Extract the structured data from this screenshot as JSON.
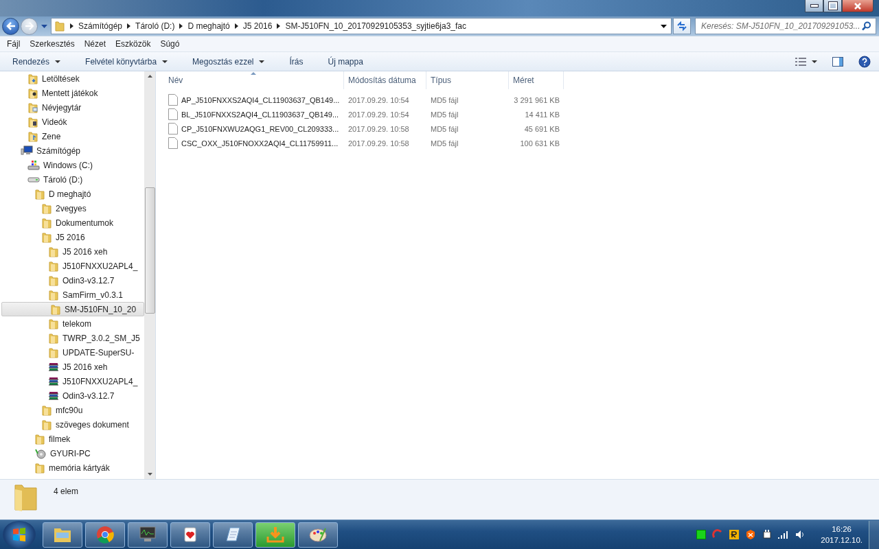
{
  "address_bar": {
    "path": [
      "Számítógép",
      "Tároló (D:)",
      "D meghajtó",
      "J5 2016",
      "SM-J510FN_10_20170929105353_syjtie6ja3_fac"
    ]
  },
  "search": {
    "placeholder": "Keresés: SM-J510FN_10_201709291053..."
  },
  "menu": [
    "Fájl",
    "Szerkesztés",
    "Nézet",
    "Eszközök",
    "Súgó"
  ],
  "toolbar": [
    {
      "label": "Rendezés",
      "dropdown": true
    },
    {
      "label": "Felvétel könyvtárba",
      "dropdown": true
    },
    {
      "label": "Megosztás ezzel",
      "dropdown": true
    },
    {
      "label": "Írás",
      "dropdown": false
    },
    {
      "label": "Új mappa",
      "dropdown": false
    }
  ],
  "sidebar": {
    "libraries": [
      {
        "label": "Letöltések",
        "kind": "downloads"
      },
      {
        "label": "Mentett játékok",
        "kind": "games"
      },
      {
        "label": "Névjegytár",
        "kind": "contacts"
      },
      {
        "label": "Videók",
        "kind": "videos"
      },
      {
        "label": "Zene",
        "kind": "music"
      }
    ],
    "tree": [
      {
        "label": "Számítógép",
        "kind": "computer",
        "selected": false,
        "children": [
          {
            "label": "Windows (C:)",
            "kind": "system-drive",
            "selected": false
          },
          {
            "label": "Tároló (D:)",
            "kind": "drive",
            "selected": false,
            "children": [
              {
                "label": "D meghajtó",
                "kind": "folder",
                "selected": false,
                "children": [
                  {
                    "label": "2vegyes",
                    "kind": "folder",
                    "selected": false
                  },
                  {
                    "label": "Dokumentumok",
                    "kind": "folder",
                    "selected": false
                  },
                  {
                    "label": "J5 2016",
                    "kind": "folder",
                    "selected": false,
                    "children": [
                      {
                        "label": "J5 2016 xeh",
                        "kind": "folder",
                        "selected": false
                      },
                      {
                        "label": "J510FNXXU2APL4_",
                        "kind": "folder",
                        "selected": false
                      },
                      {
                        "label": "Odin3-v3.12.7",
                        "kind": "folder",
                        "selected": false
                      },
                      {
                        "label": "SamFirm_v0.3.1",
                        "kind": "folder",
                        "selected": false
                      },
                      {
                        "label": "SM-J510FN_10_20",
                        "kind": "folder",
                        "selected": true
                      },
                      {
                        "label": "telekom",
                        "kind": "folder",
                        "selected": false
                      },
                      {
                        "label": "TWRP_3.0.2_SM_J5",
                        "kind": "folder",
                        "selected": false
                      },
                      {
                        "label": "UPDATE-SuperSU-",
                        "kind": "folder",
                        "selected": false
                      },
                      {
                        "label": "J5 2016 xeh",
                        "kind": "archive",
                        "selected": false
                      },
                      {
                        "label": "J510FNXXU2APL4_",
                        "kind": "archive",
                        "selected": false
                      },
                      {
                        "label": "Odin3-v3.12.7",
                        "kind": "archive",
                        "selected": false
                      }
                    ]
                  },
                  {
                    "label": "mfc90u",
                    "kind": "folder",
                    "selected": false
                  },
                  {
                    "label": "szöveges dokument",
                    "kind": "folder",
                    "selected": false
                  }
                ]
              },
              {
                "label": "filmek",
                "kind": "folder",
                "selected": false
              },
              {
                "label": "GYURI-PC",
                "kind": "network",
                "selected": false
              },
              {
                "label": "memória kártyák",
                "kind": "folder",
                "selected": false
              }
            ]
          }
        ]
      }
    ]
  },
  "table": {
    "columns": [
      "Név",
      "Módosítás dátuma",
      "Típus",
      "Méret"
    ],
    "rows": [
      [
        "AP_J510FNXXS2AQI4_CL11903637_QB149...",
        "2017.09.29. 10:54",
        "MD5 fájl",
        "3 291 961 KB"
      ],
      [
        "BL_J510FNXXS2AQI4_CL11903637_QB149...",
        "2017.09.29. 10:54",
        "MD5 fájl",
        "14 411 KB"
      ],
      [
        "CP_J510FNXWU2AQG1_REV00_CL209333...",
        "2017.09.29. 10:58",
        "MD5 fájl",
        "45 691 KB"
      ],
      [
        "CSC_OXX_J510FNOXX2AQI4_CL11759911...",
        "2017.09.29. 10:58",
        "MD5 fájl",
        "100 631 KB"
      ]
    ]
  },
  "status_bar": {
    "text": "4 elem"
  },
  "taskbar": {
    "apps": [
      {
        "kind": "explorer",
        "active": false
      },
      {
        "kind": "chrome",
        "active": false
      },
      {
        "kind": "monitor",
        "active": false
      },
      {
        "kind": "cards",
        "active": false
      },
      {
        "kind": "notepad",
        "active": false
      },
      {
        "kind": "download",
        "active": true
      },
      {
        "kind": "paint",
        "active": false
      }
    ],
    "time": "16:26",
    "date": "2017.12.10."
  }
}
